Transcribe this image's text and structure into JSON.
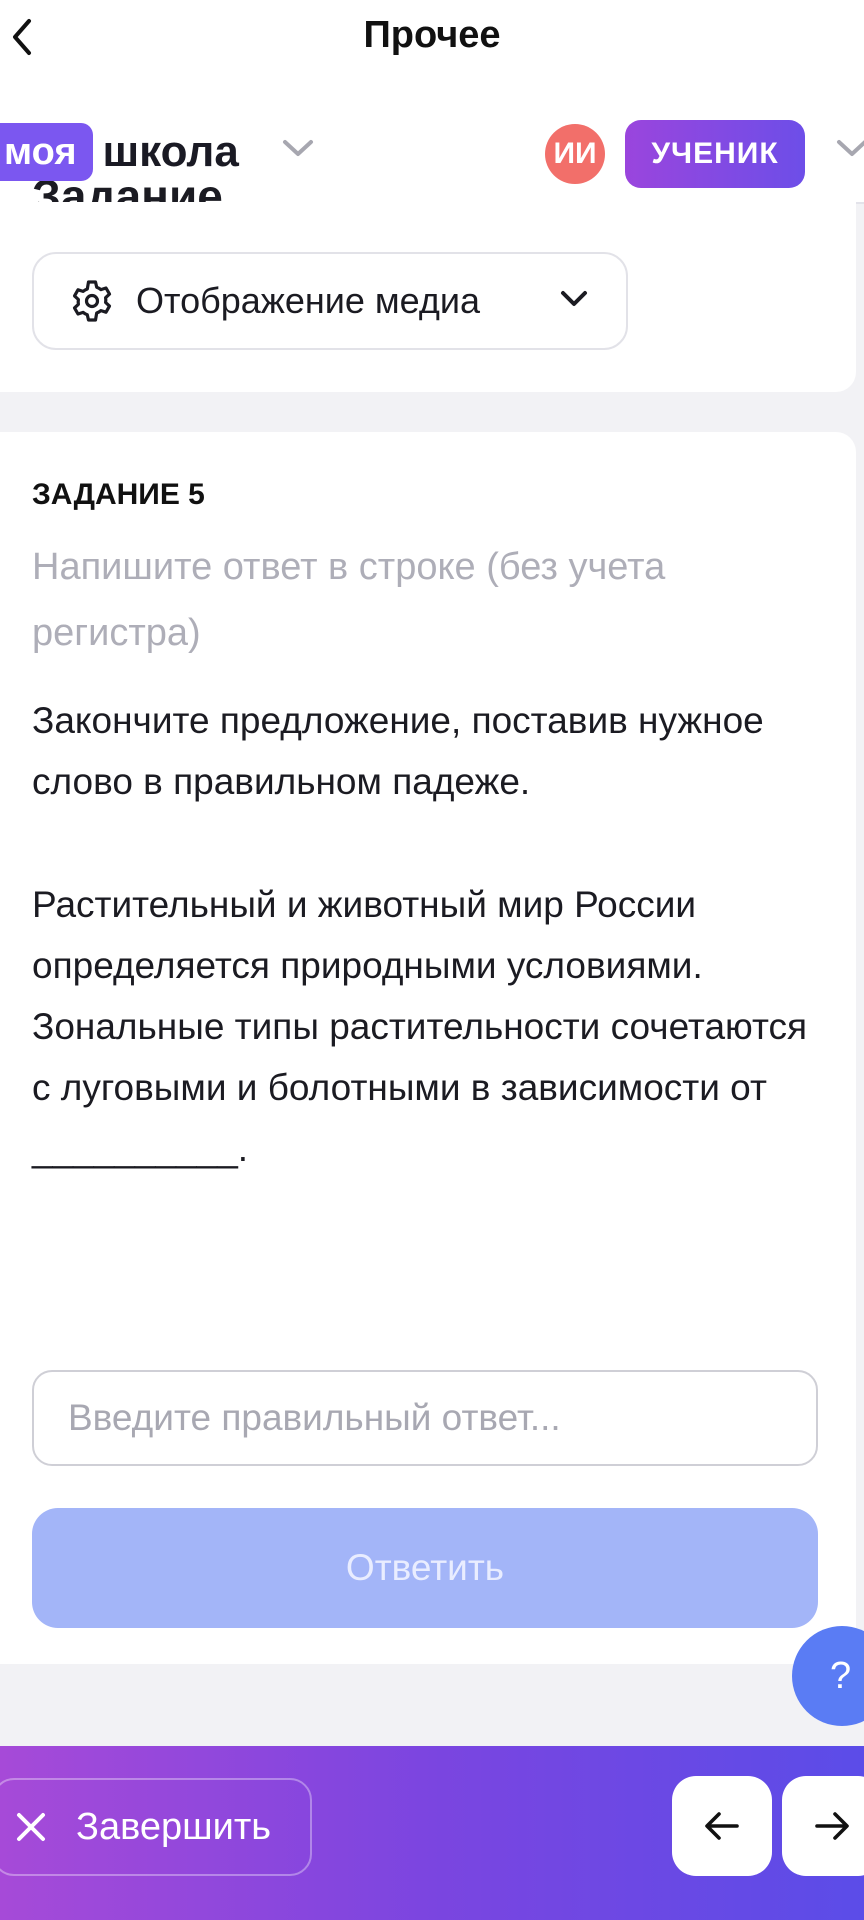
{
  "nav": {
    "title": "Прочее"
  },
  "header": {
    "logo_box": "моя",
    "logo_word": "школа",
    "avatar_initials": "ИИ",
    "role": "УЧЕНИК",
    "section_heading": "Задание"
  },
  "media": {
    "label": "Отображение медиа"
  },
  "task": {
    "number": "ЗАДАНИЕ 5",
    "hint": "Напишите ответ в строке (без учета регистра)",
    "instruction": "Закончите предложение, поставив нужное слово в правильном падеже.",
    "text": "Растительный и животный мир России определяется природными условиями. Зональные типы растительности сочетаются с луговыми и болотными в зависимости от __________.",
    "input_value": "",
    "input_placeholder": "Введите правильный ответ...",
    "submit_label": "Ответить"
  },
  "help": {
    "label": "?"
  },
  "bottom": {
    "finish_label": "Завершить"
  },
  "colors": {
    "accent": "#7b57f0",
    "avatar": "#f26f6a",
    "submit_disabled": "#a3b5f8",
    "help_fab": "#5a7cf4",
    "hint_text": "#aeaeb8"
  },
  "icons": {
    "back": "chevron-left-icon",
    "school_dropdown": "chevron-down-icon",
    "role_dropdown": "chevron-down-icon",
    "media_settings": "gear-icon",
    "media_dropdown": "chevron-down-icon",
    "finish": "close-icon",
    "prev": "arrow-left-icon",
    "next": "arrow-right-icon"
  }
}
